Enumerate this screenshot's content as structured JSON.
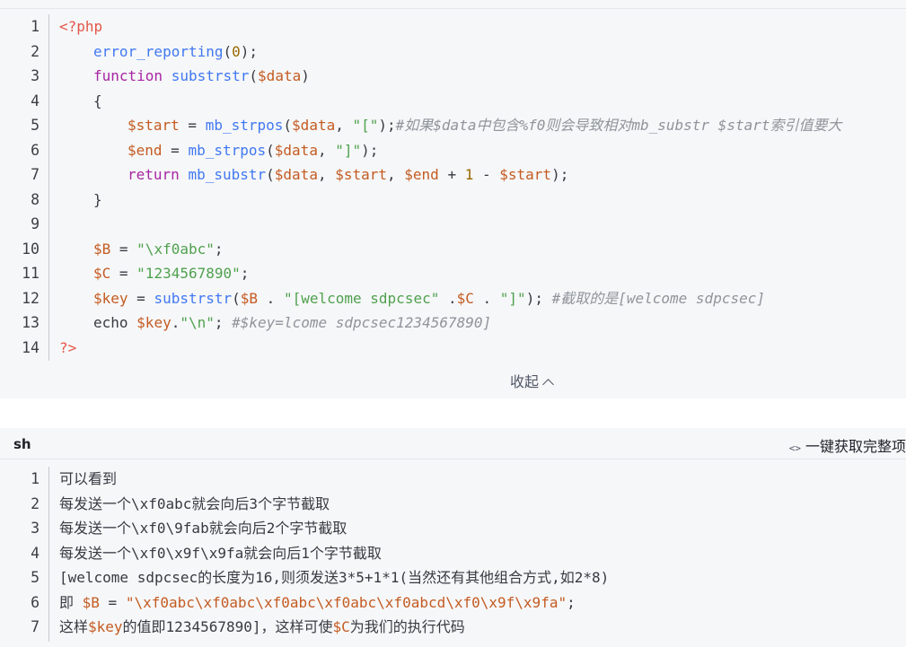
{
  "php_block": {
    "lines": [
      {
        "n": "1",
        "parts": [
          [
            "tag",
            "<?php"
          ]
        ]
      },
      {
        "n": "2",
        "indent": 1,
        "parts": [
          [
            "fn",
            "error_reporting"
          ],
          [
            "plain",
            "("
          ],
          [
            "num",
            "0"
          ],
          [
            "plain",
            ");"
          ]
        ]
      },
      {
        "n": "3",
        "indent": 1,
        "parts": [
          [
            "kw",
            "function"
          ],
          [
            "plain",
            " "
          ],
          [
            "fn",
            "substrstr"
          ],
          [
            "plain",
            "("
          ],
          [
            "var",
            "$data"
          ],
          [
            "plain",
            ")"
          ]
        ]
      },
      {
        "n": "4",
        "indent": 1,
        "parts": [
          [
            "plain",
            "{"
          ]
        ]
      },
      {
        "n": "5",
        "indent": 2,
        "parts": [
          [
            "var",
            "$start"
          ],
          [
            "plain",
            " = "
          ],
          [
            "fn",
            "mb_strpos"
          ],
          [
            "plain",
            "("
          ],
          [
            "var",
            "$data"
          ],
          [
            "plain",
            ", "
          ],
          [
            "str",
            "\"[\""
          ],
          [
            "plain",
            ");"
          ],
          [
            "cmt",
            "#如果$data中包含%f0则会导致相对mb_substr $start索引值要大"
          ]
        ]
      },
      {
        "n": "6",
        "indent": 2,
        "parts": [
          [
            "var",
            "$end"
          ],
          [
            "plain",
            " = "
          ],
          [
            "fn",
            "mb_strpos"
          ],
          [
            "plain",
            "("
          ],
          [
            "var",
            "$data"
          ],
          [
            "plain",
            ", "
          ],
          [
            "str",
            "\"]\""
          ],
          [
            "plain",
            ");"
          ]
        ]
      },
      {
        "n": "7",
        "indent": 2,
        "parts": [
          [
            "kw",
            "return"
          ],
          [
            "plain",
            " "
          ],
          [
            "fn",
            "mb_substr"
          ],
          [
            "plain",
            "("
          ],
          [
            "var",
            "$data"
          ],
          [
            "plain",
            ", "
          ],
          [
            "var",
            "$start"
          ],
          [
            "plain",
            ", "
          ],
          [
            "var",
            "$end"
          ],
          [
            "plain",
            " + "
          ],
          [
            "num",
            "1"
          ],
          [
            "plain",
            " - "
          ],
          [
            "var",
            "$start"
          ],
          [
            "plain",
            ");"
          ]
        ]
      },
      {
        "n": "8",
        "indent": 1,
        "parts": [
          [
            "plain",
            "}"
          ]
        ]
      },
      {
        "n": "9",
        "parts": []
      },
      {
        "n": "10",
        "indent": 1,
        "parts": [
          [
            "var",
            "$B"
          ],
          [
            "plain",
            " = "
          ],
          [
            "str",
            "\"\\xf0abc\""
          ],
          [
            "plain",
            ";"
          ]
        ]
      },
      {
        "n": "11",
        "indent": 1,
        "parts": [
          [
            "var",
            "$C"
          ],
          [
            "plain",
            " = "
          ],
          [
            "str",
            "\"1234567890\""
          ],
          [
            "plain",
            ";"
          ]
        ]
      },
      {
        "n": "12",
        "indent": 1,
        "parts": [
          [
            "var",
            "$key"
          ],
          [
            "plain",
            " = "
          ],
          [
            "fn",
            "substrstr"
          ],
          [
            "plain",
            "("
          ],
          [
            "var",
            "$B"
          ],
          [
            "plain",
            " . "
          ],
          [
            "str",
            "\"[welcome sdpcsec\""
          ],
          [
            "plain",
            " ."
          ],
          [
            "var",
            "$C"
          ],
          [
            "plain",
            " . "
          ],
          [
            "str",
            "\"]\""
          ],
          [
            "plain",
            "); "
          ],
          [
            "cmt",
            "#截取的是[welcome sdpcsec]"
          ]
        ]
      },
      {
        "n": "13",
        "indent": 1,
        "parts": [
          [
            "plain",
            "echo "
          ],
          [
            "var",
            "$key"
          ],
          [
            "plain",
            "."
          ],
          [
            "str",
            "\"\\n\""
          ],
          [
            "plain",
            "; "
          ],
          [
            "cmt",
            "#$key=lcome sdpcsec1234567890]"
          ]
        ]
      },
      {
        "n": "14",
        "parts": [
          [
            "tag",
            "?>"
          ]
        ]
      }
    ],
    "collapse_label": "收起"
  },
  "sh_block": {
    "language": "sh",
    "tool_icon": "<>",
    "tool_label": "一键获取完整项",
    "lines": [
      {
        "n": "1",
        "parts": [
          [
            "plain",
            "可以看到"
          ]
        ]
      },
      {
        "n": "2",
        "parts": [
          [
            "plain",
            "每发送一个\\xf0abc就会向后3个字节截取"
          ]
        ]
      },
      {
        "n": "3",
        "parts": [
          [
            "plain",
            "每发送一个\\xf0\\9fab就会向后2个字节截取"
          ]
        ]
      },
      {
        "n": "4",
        "parts": [
          [
            "plain",
            "每发送一个\\xf0\\x9f\\x9fa就会向后1个字节截取"
          ]
        ]
      },
      {
        "n": "5",
        "parts": [
          [
            "plain",
            "[welcome sdpcsec的长度为16,则须发送3*5+1*1(当然还有其他组合方式,如2*8)"
          ]
        ]
      },
      {
        "n": "6",
        "parts": [
          [
            "plain",
            "即 "
          ],
          [
            "var",
            "$B"
          ],
          [
            "plain",
            " = "
          ],
          [
            "var",
            "\"\\xf0abc\\xf0abc\\xf0abc\\xf0abc\\xf0abcd\\xf0\\x9f\\x9fa\""
          ],
          [
            "plain",
            ";"
          ]
        ]
      },
      {
        "n": "7",
        "parts": [
          [
            "plain",
            "这样"
          ],
          [
            "var",
            "$key"
          ],
          [
            "plain",
            "的值即1234567890]，这样可使"
          ],
          [
            "var",
            "$C"
          ],
          [
            "plain",
            "为我们的执行代码"
          ]
        ]
      }
    ]
  },
  "colors": {
    "block_bg": "#f6f7f8",
    "variable": "#c45b22",
    "string": "#50a14f",
    "function": "#4078f2",
    "keyword": "#a626a4",
    "comment": "#8f949b"
  }
}
